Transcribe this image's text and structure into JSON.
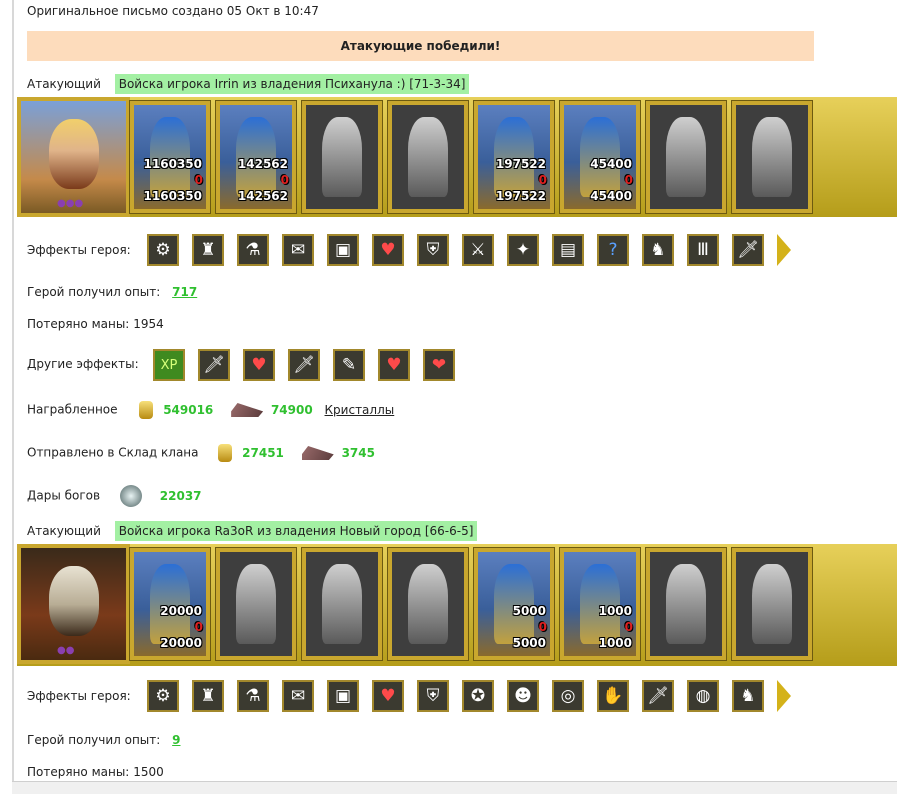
{
  "header": {
    "original_letter": "Оригинальное письмо создано 05 Окт в 10:47",
    "result_banner": "Атакующие победили!"
  },
  "attackers": [
    {
      "role_label": "Атакующий",
      "army_title": "Войска игрока Irrin из владения Психанула :) [71-3-34]",
      "troops": [
        {
          "count": "1160350",
          "lost": "0",
          "remaining": "1160350",
          "active": true
        },
        {
          "count": "142562",
          "lost": "0",
          "remaining": "142562",
          "active": true
        },
        {
          "count": "",
          "lost": "",
          "remaining": "",
          "active": false
        },
        {
          "count": "",
          "lost": "",
          "remaining": "",
          "active": false
        },
        {
          "count": "197522",
          "lost": "0",
          "remaining": "197522",
          "active": true
        },
        {
          "count": "45400",
          "lost": "0",
          "remaining": "45400",
          "active": true
        },
        {
          "count": "",
          "lost": "",
          "remaining": "",
          "active": false
        },
        {
          "count": "",
          "lost": "",
          "remaining": "",
          "active": false
        }
      ],
      "hero_effects_label": "Эффекты героя:",
      "hero_effect_icons": [
        "catapult-icon",
        "helmet-icon",
        "potion-icon",
        "gift-icon",
        "chest-icon",
        "heart-icon",
        "shield-icon",
        "spear-icon",
        "amulet-icon",
        "armor-icon",
        "question-icon",
        "boots-icon",
        "gates-icon",
        "sword-icon"
      ],
      "exp_label": "Герой получил опыт:",
      "exp_value": "717",
      "mana_label": "Потеряно маны:",
      "mana_value": "1954",
      "other_effects_label": "Другие эффекты:",
      "other_effect_icons": [
        "xp-icon",
        "sword-icon",
        "heart-sword-icon",
        "sword-icon",
        "scroll-icon",
        "heart-sword-icon",
        "hearts-icon"
      ],
      "loot_label": "Награбленное",
      "loot_gold": "549016",
      "loot_crystals": "74900",
      "loot_crystals_link": "Кристаллы",
      "clan_label": "Отправлено в Склад клана",
      "clan_gold": "27451",
      "clan_crystals": "3745",
      "gods_label": "Дары богов",
      "gods_value": "22037"
    },
    {
      "role_label": "Атакующий",
      "army_title": "Войска игрока Ra3oR из владения Новый город [66-6-5]",
      "troops": [
        {
          "count": "20000",
          "lost": "0",
          "remaining": "20000",
          "active": true
        },
        {
          "count": "",
          "lost": "",
          "remaining": "",
          "active": false
        },
        {
          "count": "",
          "lost": "",
          "remaining": "",
          "active": false
        },
        {
          "count": "",
          "lost": "",
          "remaining": "",
          "active": false
        },
        {
          "count": "5000",
          "lost": "0",
          "remaining": "5000",
          "active": true
        },
        {
          "count": "1000",
          "lost": "0",
          "remaining": "1000",
          "active": true
        },
        {
          "count": "",
          "lost": "",
          "remaining": "",
          "active": false
        },
        {
          "count": "",
          "lost": "",
          "remaining": "",
          "active": false
        }
      ],
      "hero_effects_label": "Эффекты героя:",
      "hero_effect_icons": [
        "catapult-icon",
        "helmet-icon",
        "potion-icon",
        "gift-icon",
        "chest-icon",
        "heart-icon",
        "shield-icon",
        "pentagram-icon",
        "mask-icon",
        "ring-icon",
        "gauntlet-icon",
        "sword-icon",
        "shield-round-icon",
        "boots-icon"
      ],
      "exp_label": "Герой получил опыт:",
      "exp_value": "9",
      "mana_label": "Потеряно маны:",
      "mana_value": "1500"
    }
  ],
  "colors": {
    "banner_bg": "#fddcbc",
    "army_title_bg": "#a3f0a3",
    "value_green": "#30c030",
    "frame_gold": "#c9a72e"
  }
}
